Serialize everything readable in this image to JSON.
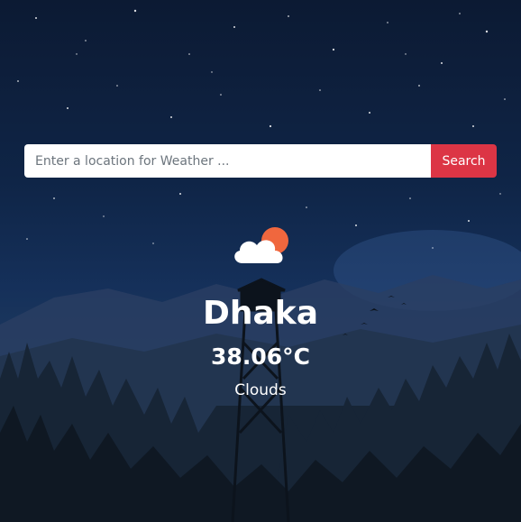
{
  "search": {
    "placeholder": "Enter a location for Weather ...",
    "value": "",
    "button_label": "Search"
  },
  "weather": {
    "icon": "cloud-sun-icon",
    "city": "Dhaka",
    "temperature": "38.06°C",
    "description": "Clouds"
  },
  "colors": {
    "accent": "#dc3545",
    "sun": "#f0673e"
  }
}
